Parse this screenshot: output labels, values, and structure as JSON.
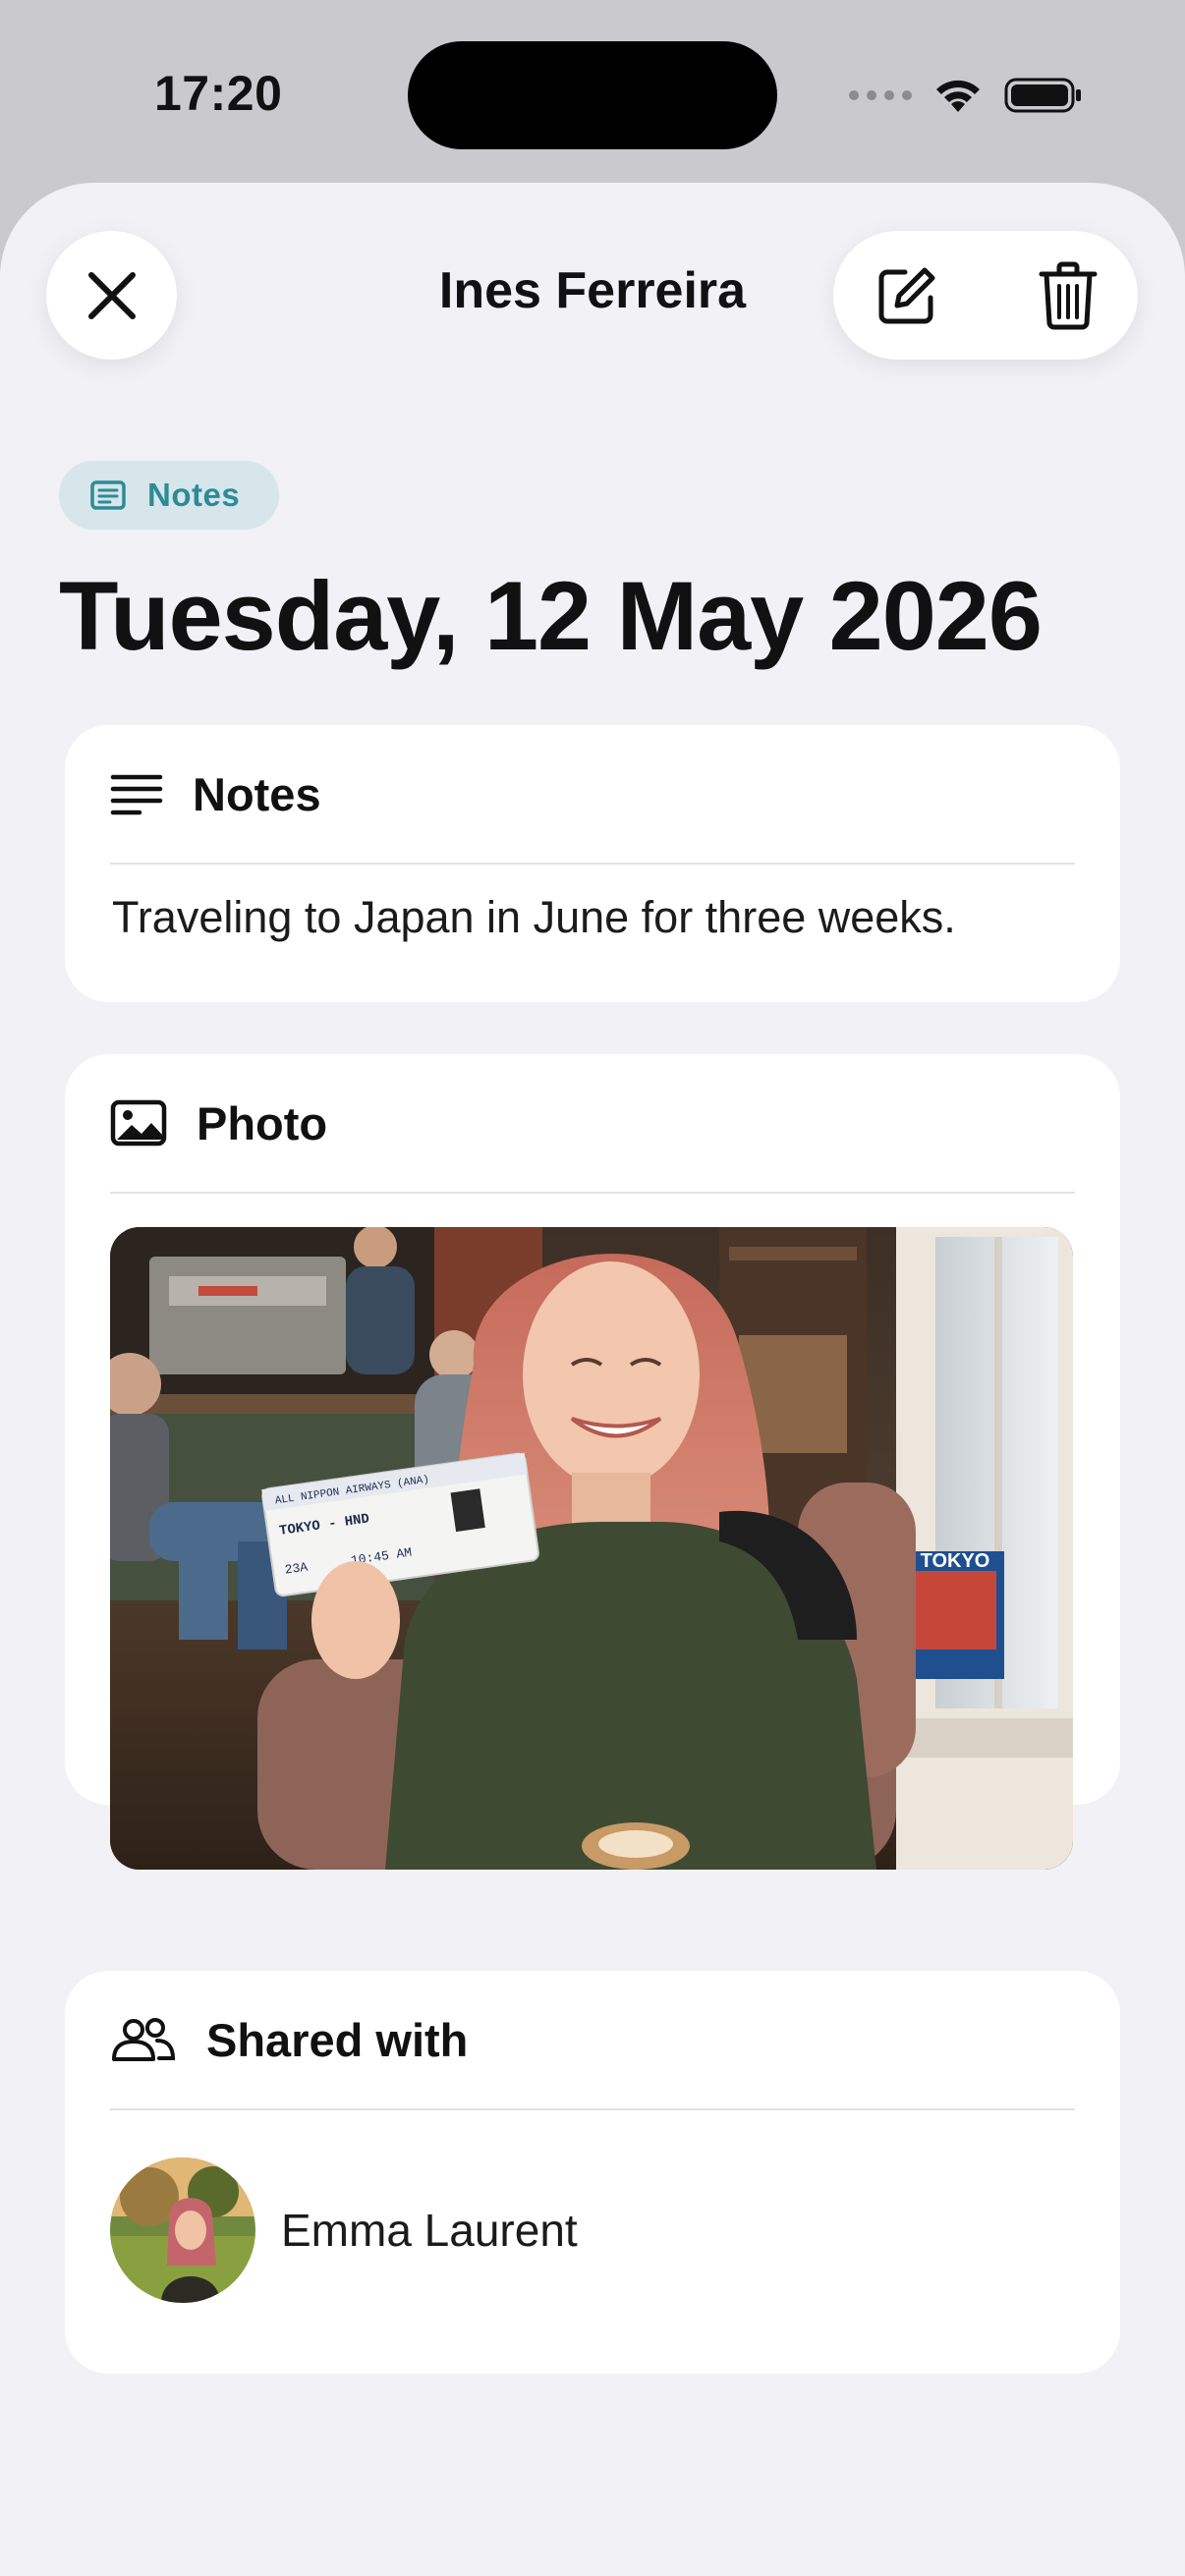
{
  "status_bar": {
    "time": "17:20"
  },
  "header": {
    "title": "Ines Ferreira",
    "close_icon": "close-icon",
    "edit_icon": "edit-icon",
    "delete_icon": "trash-icon"
  },
  "category": {
    "label": "Notes",
    "icon": "note-icon",
    "color": "#2d8b96",
    "background": "#d6e6ea"
  },
  "entry": {
    "date": "Tuesday, 12 May 2026"
  },
  "notes_section": {
    "title": "Notes",
    "icon": "text-lines-icon",
    "body": "Traveling to Japan in June for three weeks."
  },
  "photo_section": {
    "title": "Photo",
    "icon": "photo-icon",
    "boarding_pass_header": "ALL NIPPON AIRWAYS (ANA)",
    "boarding_pass_route": "TOKYO - HND",
    "boarding_pass_seat": "23A",
    "boarding_pass_time": "10:45 AM",
    "book_title": "TOKYO"
  },
  "shared_section": {
    "title": "Shared with",
    "icon": "people-icon",
    "people": [
      {
        "name": "Emma Laurent"
      }
    ]
  }
}
